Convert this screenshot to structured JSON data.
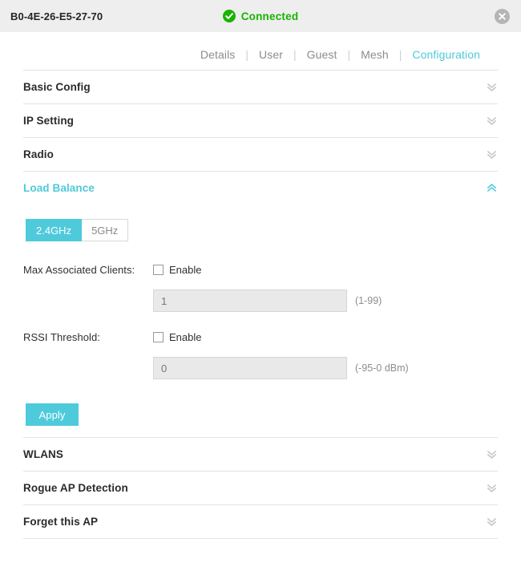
{
  "header": {
    "mac_address": "B0-4E-26-E5-27-70",
    "status_text": "Connected",
    "status_icon": "check-circle-icon",
    "status_color": "#18b400",
    "close_icon": "close-circle-icon"
  },
  "tabs": {
    "items": [
      {
        "label": "Details",
        "active": false
      },
      {
        "label": "User",
        "active": false
      },
      {
        "label": "Guest",
        "active": false
      },
      {
        "label": "Mesh",
        "active": false
      },
      {
        "label": "Configuration",
        "active": true
      }
    ],
    "separator": "|"
  },
  "accent_color": "#4ecadb",
  "sections": [
    {
      "title": "Basic Config",
      "expanded": false,
      "chevron_icon": "chevron-double-down-icon"
    },
    {
      "title": "IP Setting",
      "expanded": false,
      "chevron_icon": "chevron-double-down-icon"
    },
    {
      "title": "Radio",
      "expanded": false,
      "chevron_icon": "chevron-double-down-icon"
    },
    {
      "title": "Load Balance",
      "expanded": true,
      "chevron_icon": "chevron-double-up-icon"
    },
    {
      "title": "WLANS",
      "expanded": false,
      "chevron_icon": "chevron-double-down-icon"
    },
    {
      "title": "Rogue AP Detection",
      "expanded": false,
      "chevron_icon": "chevron-double-down-icon"
    },
    {
      "title": "Forget this AP",
      "expanded": false,
      "chevron_icon": "chevron-double-down-icon"
    }
  ],
  "load_balance": {
    "bands": [
      {
        "label": "2.4GHz",
        "selected": true
      },
      {
        "label": "5GHz",
        "selected": false
      }
    ],
    "max_clients": {
      "label": "Max Associated Clients:",
      "enable_label": "Enable",
      "enabled": false,
      "value": "",
      "placeholder": "1",
      "hint": "(1-99)"
    },
    "rssi_threshold": {
      "label": "RSSI Threshold:",
      "enable_label": "Enable",
      "enabled": false,
      "value": "",
      "placeholder": "0",
      "hint": "(-95-0 dBm)"
    },
    "apply_label": "Apply"
  }
}
